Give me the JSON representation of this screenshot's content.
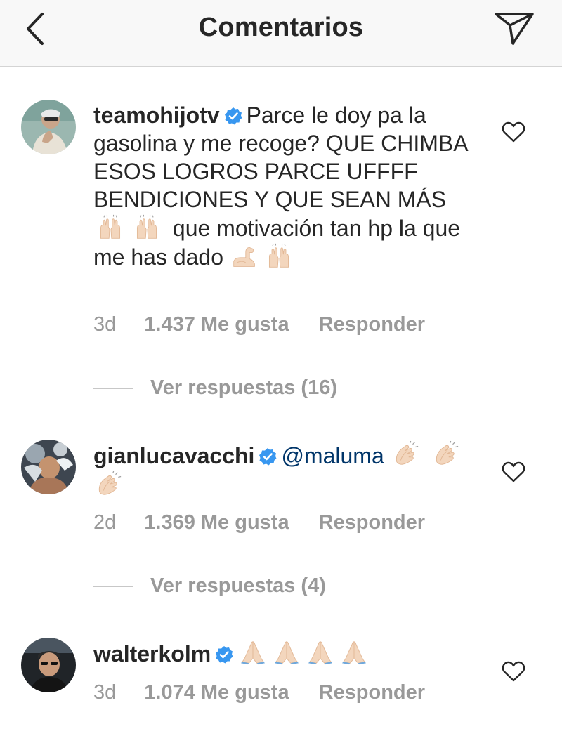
{
  "header": {
    "title": "Comentarios"
  },
  "comments": [
    {
      "username": "teamohijotv",
      "text_before": "Parce le doy pa la gasolina y me recoge? QUE CHIMBA ESOS LOGROS PARCE UFFFF BENDICIONES Y QUE SEAN MÁS",
      "text_middle": "que motivación tan hp la que me has dado",
      "time": "3d",
      "likes": "1.437 Me gusta",
      "reply_label": "Responder",
      "replies_label": "Ver respuestas (16)"
    },
    {
      "username": "gianlucavacchi",
      "mention": "@maluma",
      "time": "2d",
      "likes": "1.369 Me gusta",
      "reply_label": "Responder",
      "replies_label": "Ver respuestas (4)"
    },
    {
      "username": "walterkolm",
      "time": "3d",
      "likes": "1.074 Me gusta",
      "reply_label": "Responder"
    }
  ],
  "colors": {
    "verified": "#3897f0",
    "mention": "#003569",
    "muted": "#999999",
    "header_bg": "#f8f8f8"
  },
  "icons": {
    "back": "chevron-left-icon",
    "send": "paper-plane-icon",
    "like": "heart-outline-icon",
    "verified": "verified-badge-icon",
    "raised_hands": "raised-hands-emoji",
    "flexed_biceps": "flexed-biceps-emoji",
    "clapping_hands": "clapping-hands-emoji",
    "folded_hands": "folded-hands-emoji"
  }
}
